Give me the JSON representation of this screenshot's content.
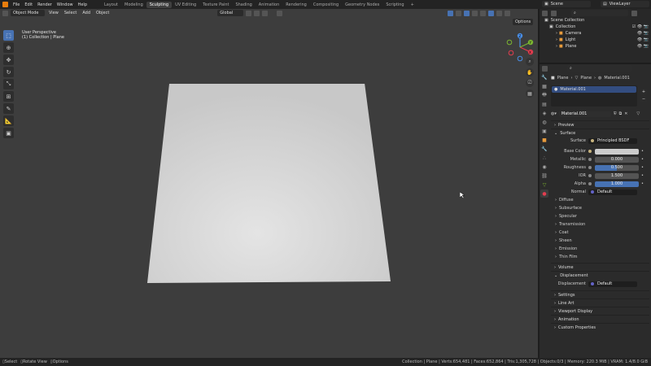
{
  "menu": [
    "File",
    "Edit",
    "Render",
    "Window",
    "Help"
  ],
  "workspaces": [
    {
      "label": "Layout",
      "active": false
    },
    {
      "label": "Modeling",
      "active": false
    },
    {
      "label": "Sculpting",
      "active": true
    },
    {
      "label": "UV Editing",
      "active": false
    },
    {
      "label": "Texture Paint",
      "active": false
    },
    {
      "label": "Shading",
      "active": false
    },
    {
      "label": "Animation",
      "active": false
    },
    {
      "label": "Rendering",
      "active": false
    },
    {
      "label": "Compositing",
      "active": false
    },
    {
      "label": "Geometry Nodes",
      "active": false
    },
    {
      "label": "Scripting",
      "active": false
    }
  ],
  "add_workspace": "+",
  "scene": {
    "name": "Scene",
    "view_layer": "ViewLayer"
  },
  "viewport": {
    "mode": "Object Mode",
    "menus": [
      "View",
      "Select",
      "Add",
      "Object"
    ],
    "transform": "Global",
    "options": "Options",
    "perspective": "User Perspective",
    "collection_info": "(1) Collection | Plane",
    "gizmo": {
      "x": "X",
      "y": "Y",
      "z": "Z"
    }
  },
  "outliner": {
    "search_placeholder": "",
    "rows": [
      {
        "label": "Scene Collection",
        "indent": 0
      },
      {
        "label": "Collection",
        "indent": 1
      },
      {
        "label": "Camera",
        "indent": 2
      },
      {
        "label": "Light",
        "indent": 2
      },
      {
        "label": "Plane",
        "indent": 2
      }
    ]
  },
  "properties": {
    "breadcrumb": [
      "Plane",
      "Plane",
      "Material.001"
    ],
    "slot": "Material.001",
    "material_name": "Material.001",
    "sections": {
      "preview": "Preview",
      "surface": "Surface",
      "volume": "Volume",
      "displacement": "Displacement",
      "settings": "Settings",
      "line_art": "Line Art",
      "viewport_display": "Viewport Display",
      "animation": "Animation",
      "custom_properties": "Custom Properties"
    },
    "surface_rows": [
      {
        "label": "Surface",
        "value": "Principled BSDF",
        "style": "dark"
      },
      {
        "label": "Base Color",
        "value": "",
        "style": "color"
      },
      {
        "label": "Metallic",
        "value": "0.000",
        "style": "grey"
      },
      {
        "label": "Roughness",
        "value": "0.500",
        "style": "blue"
      },
      {
        "label": "IOR",
        "value": "1.500",
        "style": "grey"
      },
      {
        "label": "Alpha",
        "value": "1.000",
        "style": "blue"
      },
      {
        "label": "Normal",
        "value": "Default",
        "style": "plain"
      }
    ],
    "subpanels": [
      "Diffuse",
      "Subsurface",
      "Specular",
      "Transmission",
      "Coat",
      "Sheen",
      "Emission",
      "Thin Film"
    ],
    "displacement_row": {
      "label": "Displacement",
      "value": "Default"
    }
  },
  "status": {
    "left": [
      {
        "key": "Select"
      },
      {
        "key": "Rotate View"
      },
      {
        "key": "Options"
      }
    ],
    "right": "Collection | Plane | Verts:654,481 | Faces:652,864 | Tris:1,305,728 | Objects:0/3 | Memory: 220.3 MiB | VRAM: 1.4/8.0 GiB"
  },
  "colors": {
    "accent": "#4772b3",
    "viewport_bg": "#3d3d3d",
    "panel_bg": "#2b2b2b"
  }
}
